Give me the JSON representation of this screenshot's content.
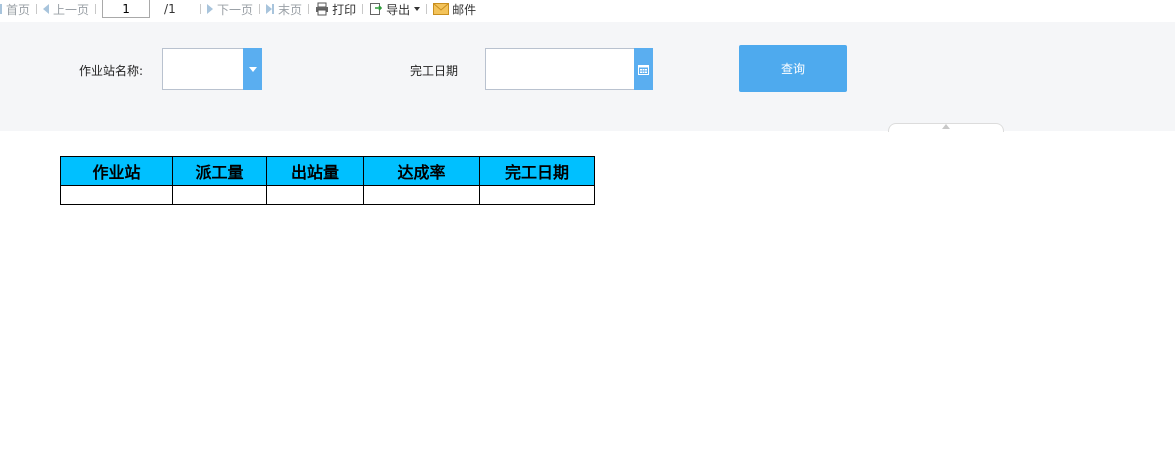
{
  "toolbar": {
    "first": "首页",
    "prev": "上一页",
    "page_current": "1",
    "page_total": "/1",
    "next": "下一页",
    "last": "末页",
    "print": "打印",
    "export": "导出",
    "email": "邮件"
  },
  "filters": {
    "station_label": "作业站名称:",
    "station_value": "",
    "date_label": "完工日期",
    "date_value": "",
    "query_label": "查询"
  },
  "table": {
    "headers": [
      "作业站",
      "派工量",
      "出站量",
      "达成率",
      "完工日期"
    ],
    "rows": [
      [
        "",
        "",
        "",
        "",
        ""
      ]
    ]
  },
  "colors": {
    "header_bg": "#00c0ff",
    "accent": "#4eaaee",
    "panel_bg": "#f5f6f8"
  }
}
